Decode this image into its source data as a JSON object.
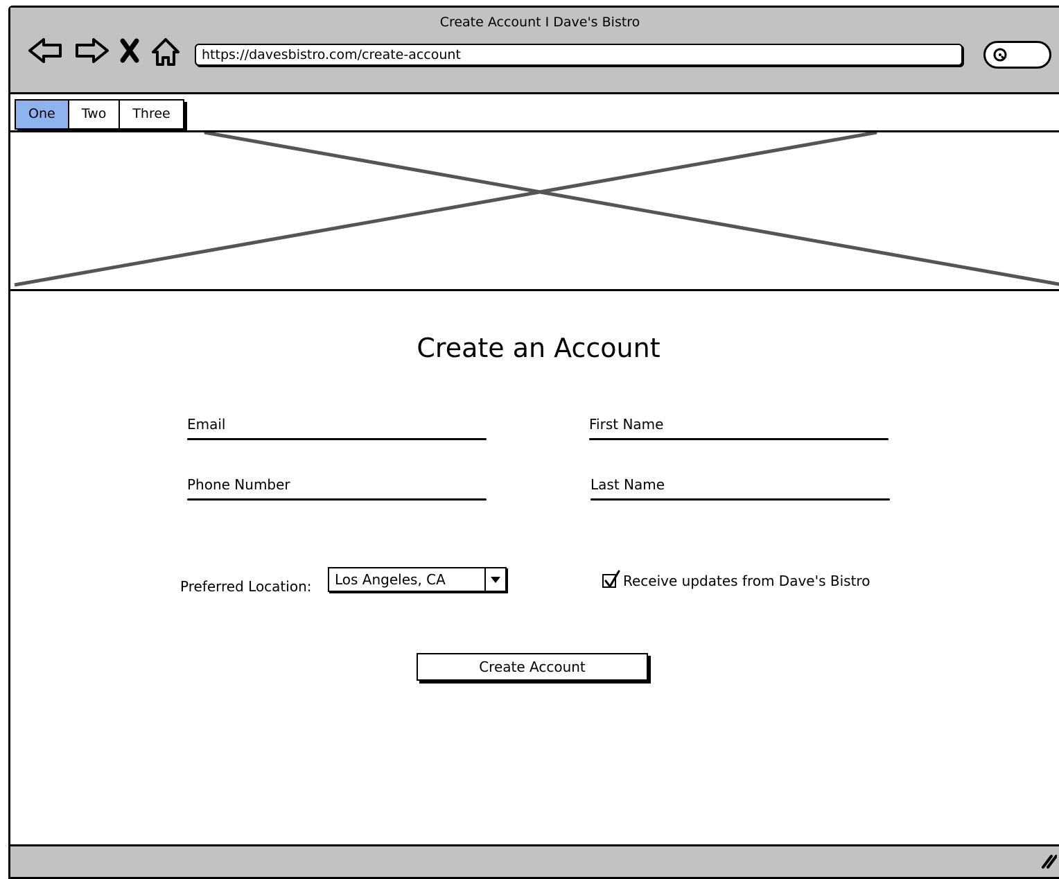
{
  "window": {
    "title": "Create Account I Dave's Bistro"
  },
  "browser": {
    "url": "https://davesbistro.com/create-account",
    "nav_icons": [
      "back-arrow-icon",
      "forward-arrow-icon",
      "close-x-icon",
      "home-icon"
    ],
    "search_icon": "search-icon"
  },
  "tabs": [
    {
      "label": "One",
      "active": true
    },
    {
      "label": "Two",
      "active": false
    },
    {
      "label": "Three",
      "active": false
    }
  ],
  "form": {
    "heading": "Create an Account",
    "fields": {
      "email": "Email",
      "first_name": "First Name",
      "phone": "Phone Number",
      "last_name": "Last Name"
    },
    "location_label": "Preferred Location:",
    "location_value": "Los Angeles, CA",
    "updates_label": "Receive updates from Dave's Bistro",
    "updates_checked": true,
    "submit_label": "Create Account"
  },
  "colors": {
    "chrome": "#c2c2c2",
    "active_tab": "#8fb3ee",
    "placeholder_x": "#555555"
  }
}
